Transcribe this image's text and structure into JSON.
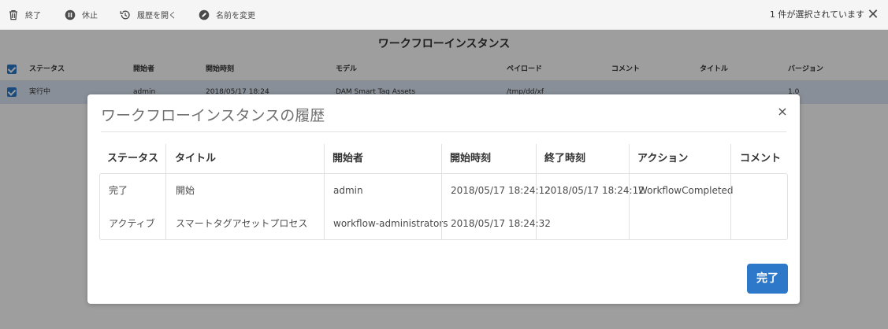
{
  "actionbar": {
    "end_label": "終了",
    "suspend_label": "休止",
    "history_label": "履歴を開く",
    "rename_label": "名前を変更",
    "selection_text": "1 件が選択されています",
    "close_glyph": "✕"
  },
  "page": {
    "title": "ワークフローインスタンス"
  },
  "table": {
    "headers": [
      "ステータス",
      "開始者",
      "開始時刻",
      "モデル",
      "ペイロード",
      "コメント",
      "タイトル",
      "バージョン"
    ],
    "row": {
      "status": "実行中",
      "initiator": "admin",
      "start_time": "2018/05/17 18:24",
      "model": "DAM Smart Tag Assets",
      "payload": "/tmp/dd/xf",
      "version": "1.0"
    }
  },
  "dialog": {
    "title": "ワークフローインスタンスの履歴",
    "close_glyph": "×",
    "headers": [
      "ステータス",
      "タイトル",
      "開始者",
      "開始時刻",
      "終了時刻",
      "アクション",
      "コメント"
    ],
    "rows": [
      [
        "完了",
        "開始",
        "admin",
        "2018/05/17 18:24:12",
        "2018/05/17 18:24:12",
        "WorkflowCompleted",
        ""
      ],
      [
        "アクティブ",
        "スマートタグアセットプロセス",
        "workflow-administrators",
        "2018/05/17 18:24:32",
        "",
        "",
        ""
      ]
    ],
    "done_label": "完了"
  },
  "colors": {
    "accent": "#2d78c8",
    "selected_row": "#dde7f5"
  }
}
